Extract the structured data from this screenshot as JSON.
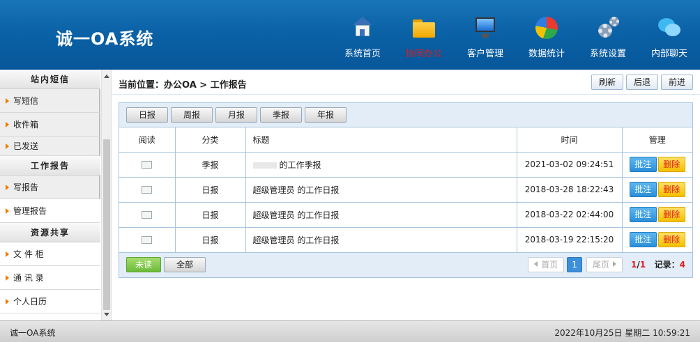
{
  "app": {
    "title": "诚一OA系统"
  },
  "nav": [
    {
      "label": "系统首页",
      "icon": "home-icon"
    },
    {
      "label": "协同办公",
      "icon": "folder-icon",
      "active": true
    },
    {
      "label": "客户管理",
      "icon": "monitor-icon"
    },
    {
      "label": "数据统计",
      "icon": "pie-chart-icon"
    },
    {
      "label": "系统设置",
      "icon": "gear-icon"
    },
    {
      "label": "内部聊天",
      "icon": "chat-icon"
    }
  ],
  "sidebar": {
    "sections": [
      {
        "title": "站内短信",
        "items": [
          "写短信",
          "收件箱",
          "已发送"
        ]
      },
      {
        "title": "工作报告",
        "items": [
          "写报告",
          "管理报告"
        ]
      },
      {
        "title": "资源共享",
        "items": [
          "文 件 柜",
          "通 讯 录",
          "个人日历"
        ]
      }
    ]
  },
  "breadcrumb": "当前位置：办公OA > 工作报告",
  "top_buttons": {
    "refresh": "刷新",
    "back": "后退",
    "forward": "前进"
  },
  "tabs": [
    "日报",
    "周报",
    "月报",
    "季报",
    "年报"
  ],
  "table": {
    "headers": {
      "read": "阅读",
      "category": "分类",
      "title": "标题",
      "time": "时间",
      "manage": "管理"
    },
    "rows": [
      {
        "category": "季报",
        "title": "的工作季报",
        "time": "2021-03-02 09:24:51"
      },
      {
        "category": "日报",
        "title": "超级管理员 的工作日报",
        "time": "2018-03-28 18:22:43"
      },
      {
        "category": "日报",
        "title": "超级管理员 的工作日报",
        "time": "2018-03-22 02:44:00"
      },
      {
        "category": "日报",
        "title": "超级管理员 的工作日报",
        "time": "2018-03-19 22:15:20"
      }
    ],
    "actions": {
      "note": "批注",
      "delete": "删除"
    }
  },
  "footer": {
    "unread": "未读",
    "all": "全部",
    "pager": {
      "first": "首页",
      "page": "1",
      "last": "尾页",
      "current": "1",
      "total": "1",
      "records_label": "记录：",
      "records": "4"
    }
  },
  "status": {
    "app_name": "诚一OA系统",
    "datetime": "2022年10月25日 星期二   10:59:21"
  },
  "colors": {
    "header": "#0b62a6",
    "accent_red": "#e0201b",
    "note_blue": "#2a8fd9",
    "delete_yellow": "#f5c000",
    "unread_green": "#6cba3a"
  }
}
